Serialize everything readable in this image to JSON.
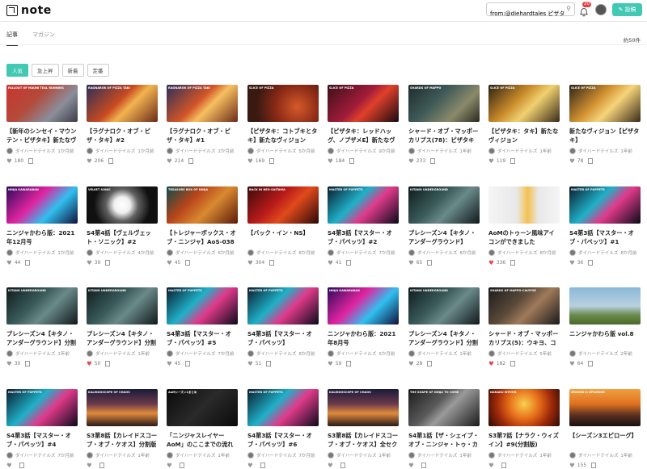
{
  "header": {
    "logo_text": "note",
    "search_value": "from:@diehardtales ピザタキ",
    "notification_count": "20",
    "post_label": "投稿"
  },
  "tabs": [
    {
      "label": "記事"
    },
    {
      "label": "マガジン"
    }
  ],
  "count": "約50件",
  "filters": [
    {
      "label": "人気"
    },
    {
      "label": "急上昇"
    },
    {
      "label": "新着"
    },
    {
      "label": "定番"
    }
  ],
  "colors": {
    "accent": "#41c9b4",
    "like_on": "#e34a4a"
  },
  "cards": [
    {
      "title": "【新年のシンセイ・マウンテン・ピザタキ】新たなヴィジョン",
      "author": "ダイハードテイルズ",
      "time": "1か月前",
      "likes": "180",
      "liked": false,
      "thumb_caption": "FALLOUT OF MAUNI\nTEAL RUNNING",
      "thumb": "linear-gradient(135deg,#c9352f,#b44a3a 40%,#8a8e9a 70%,#3a3d48)"
    },
    {
      "title": "【ラグナロク・オブ・ピザ・タキ】#2",
      "author": "ダイハードテイルズ",
      "time": "1か月前",
      "likes": "206",
      "liked": false,
      "thumb_caption": "RAGNAROK OF PIZZA TAKI",
      "thumb": "linear-gradient(135deg,#2a2f5a,#c84a20 45%,#f2b450 60%,#6a2a18)"
    },
    {
      "title": "【ラグナロク・オブ・ピザ・タキ】#1",
      "author": "ダイハードテイルズ",
      "time": "2か月前",
      "likes": "214",
      "liked": false,
      "thumb_caption": "RAGNAROK OF PIZZA TAKI",
      "thumb": "linear-gradient(135deg,#2a2f5a,#d25528 45%,#f7c060 60%,#6a2a18)"
    },
    {
      "title": "【ピザタキ：コトブキとタキ】新たなヴィジョン",
      "author": "ダイハードテイルズ",
      "time": "5か月前",
      "likes": "169",
      "liked": false,
      "thumb_caption": "SLICE OF PIZZA",
      "thumb": "radial-gradient(circle at 70% 60%,#d65a2a,#8a2a16 40%,#3a1a10 75%)"
    },
    {
      "title": "【ピザタキ：レッドハッグ、ノプザメE】新たなヴィジョン",
      "author": "ダイハードテイルズ",
      "time": "9か月前",
      "likes": "184",
      "liked": false,
      "thumb_caption": "SLICE OF PIZZA",
      "thumb": "linear-gradient(135deg,#3a0f18,#a01c3a 45%,#e0402a 60%,#1a0a10)"
    },
    {
      "title": "シャード・オブ・マッポーカリプス(78)：ピザタキ",
      "author": "ダイハードテイルズ",
      "time": "1年前",
      "likes": "233",
      "liked": false,
      "thumb_caption": "SHARDS OF MAPPO",
      "thumb": "linear-gradient(135deg,#1e2a2c,#3f5a58 40%,#8a8a6a 70%,#2a2a20)"
    },
    {
      "title": "【ピザタキ：タキ】新たなヴィジョン",
      "author": "ダイハードテイルズ",
      "time": "1年前",
      "likes": "119",
      "liked": false,
      "thumb_caption": "SLICE OF PIZZA",
      "thumb": "linear-gradient(135deg,#2a2012,#c88a2a 40%,#f0d070 60%,#3a2a18)"
    },
    {
      "title": "新たなヴィジョン【ピザタキ】",
      "author": "ダイハードテイルズ",
      "time": "1年前",
      "likes": "78",
      "liked": false,
      "thumb_caption": "SLICE OF PIZZA",
      "thumb": "linear-gradient(135deg,#2a2218,#d09030 40%,#f6d47a 60%,#3a2a18)"
    },
    {
      "title": "ニンジャかわら版：2021年12月号",
      "author": "ダイハードテイルズ",
      "time": "1か月前",
      "likes": "44",
      "liked": false,
      "thumb_caption": "NINJA KAWARABAN",
      "thumb": "linear-gradient(135deg,#2a0a5a,#e024a0 40%,#30c0f0 65%,#10103a)"
    },
    {
      "title": "S4第4話【ヴェルヴェット・ソニック】#2",
      "author": "ダイハードテイルズ",
      "time": "4か月前",
      "likes": "39",
      "liked": false,
      "thumb_caption": "VELVET SONIC",
      "thumb": "radial-gradient(circle at 50% 50%,#ffffff,#f0f0f0 20%,#606060 40%,#101010 70%)"
    },
    {
      "title": "【トレジャーボックス・オブ・ニンジャ】AoS-038「タキ」",
      "author": "ダイハードテイルズ",
      "time": "6か月前",
      "likes": "45",
      "liked": false,
      "thumb_caption": "TREASURE BOX OF NINJA",
      "thumb": "linear-gradient(135deg,#0c4a4a,#b8451a 35%,#d88a30 60%,#5a1a0a)"
    },
    {
      "title": "【バック・イン・NS】",
      "author": "ダイハードテイルズ",
      "time": "8か月前",
      "likes": "304",
      "liked": false,
      "thumb_caption": "BACK IN NEO-SAITAMA",
      "thumb": "linear-gradient(135deg,#3a0a0a,#b81a1a 40%,#e04a1a 60%,#2a0808)"
    },
    {
      "title": "S4第3話【マスター・オブ・パペッツ】#2",
      "author": "ダイハードテイルズ",
      "time": "7か月前",
      "likes": "41",
      "liked": false,
      "thumb_caption": "MASTER OF PUPPETS",
      "thumb": "linear-gradient(135deg,#0a1a2a,#20b0c8 40%,#e03a8a 60%,#0a0a1a)"
    },
    {
      "title": "プレシーズン4【キタノ・アンダーグラウンド】",
      "author": "ダイハードテイルズ",
      "time": "8か月前",
      "likes": "65",
      "liked": false,
      "thumb_caption": "KITANO UNDERGROUND",
      "thumb": "linear-gradient(135deg,#0e1a1c,#3a5a5a 40%,#6a8a8a 60%,#10181a)"
    },
    {
      "title": "AoMのトゥーン風味アイコンができました",
      "author": "ダイハードテイルズ",
      "time": "8か月前",
      "likes": "336",
      "liked": true,
      "thumb_caption": "",
      "thumb": "linear-gradient(90deg,#f5f5f5,#e8e8e8 40%,#f4c050 55%,#e8e8e8 70%,#f5f5f5)"
    },
    {
      "title": "S4第3話【マスター・オブ・パペッツ】#1",
      "author": "ダイハードテイルズ",
      "time": "8か月前",
      "likes": "36",
      "liked": false,
      "thumb_caption": "MASTER OF PUPPETS",
      "thumb": "linear-gradient(135deg,#0a1a2a,#20b0c8 40%,#e03a8a 60%,#0a0a1a)"
    },
    {
      "title": "プレシーズン4【キタノ・アンダーグラウンド】分割版#2",
      "author": "ダイハードテイルズ",
      "time": "1年前",
      "likes": "30",
      "liked": false,
      "thumb_caption": "KITANO UNDERGROUND",
      "thumb": "linear-gradient(135deg,#0e1a1c,#3a5a5a 40%,#6a8a8a 60%,#10181a)"
    },
    {
      "title": "プレシーズン4【キタノ・アンダーグラウンド】分割版#5",
      "author": "ダイハードテイルズ",
      "time": "1年前",
      "likes": "50",
      "liked": true,
      "thumb_caption": "KITANO UNDERGROUND",
      "thumb": "linear-gradient(135deg,#0e1a1c,#3a5a5a 40%,#6a8a8a 60%,#10181a)"
    },
    {
      "title": "S4第3話【マスター・オブ・パペッツ】#5",
      "author": "ダイハードテイルズ",
      "time": "7か月前",
      "likes": "45",
      "liked": false,
      "thumb_caption": "MASTER OF PUPPETS",
      "thumb": "linear-gradient(135deg,#0a1a2a,#20b0c8 40%,#e03a8a 60%,#0a0a1a)"
    },
    {
      "title": "S4第3話【マスター・オブ・パペッツ】",
      "author": "ダイハードテイルズ",
      "time": "8か月前",
      "likes": "51",
      "liked": false,
      "thumb_caption": "MASTER OF PUPPETS",
      "thumb": "linear-gradient(135deg,#0a1a2a,#20b0c8 40%,#e03a8a 60%,#0a0a1a)"
    },
    {
      "title": "ニンジャかわら版：2021年8月号",
      "author": "ダイハードテイルズ",
      "time": "5か月前",
      "likes": "59",
      "liked": false,
      "thumb_caption": "NINJA KAWARABAN",
      "thumb": "linear-gradient(135deg,#2a0a5a,#e024a0 40%,#30c0f0 65%,#10103a)"
    },
    {
      "title": "プレシーズン4【キタノ・アンダーグラウンド】分割版#1",
      "author": "ダイハードテイルズ",
      "time": "1年前",
      "likes": "28",
      "liked": false,
      "thumb_caption": "KITANO UNDERGROUND",
      "thumb": "linear-gradient(135deg,#0e1a1c,#3a5a5a 40%,#6a8a8a 60%,#10181a)"
    },
    {
      "title": "シャード・オブ・マッポーカリプス(5)：ウキヨ、コトブキ",
      "author": "ダイハードテイルズ",
      "time": "5年前",
      "likes": "182",
      "liked": true,
      "thumb_caption": "SHARDS OF MAPPO-CALYPSE",
      "thumb": "linear-gradient(135deg,#1a1a1a,#5a4a3a 40%,#a07a5a 60%,#1a1a1a)"
    },
    {
      "title": "ニンジャかわら版 vol.8",
      "author": "ダイハードテイルズ",
      "time": "2年前",
      "likes": "64",
      "liked": false,
      "thumb_caption": "",
      "thumb": "linear-gradient(180deg,#8ab8d8,#b8d0e0 50%,#6a8a4a 75%,#4a6a2a)"
    },
    {
      "title": "S4第3話【マスター・オブ・パペッツ】#4",
      "author": "ダイハードテイルズ",
      "time": "7か月前",
      "likes": "",
      "liked": false,
      "thumb_caption": "MASTER OF PUPPETS",
      "thumb": "linear-gradient(135deg,#0a1a2a,#20b0c8 40%,#e03a8a 60%,#0a0a1a)"
    },
    {
      "title": "S3第8話【カレイドスコープ・オブ・ケオス】分割版#2",
      "author": "ダイハードテイルズ",
      "time": "1年前",
      "likes": "",
      "liked": false,
      "thumb_caption": "KALEIDOSCOPE OF CHAOS",
      "thumb": "linear-gradient(180deg,#1a1a3a,#6a3a4a 40%,#e08a3a 65%,#2a1a1a)"
    },
    {
      "title": "「ニンジャスレイヤーAoM」のここまでの流れが3分でわかるまとめ",
      "author": "ダイハードテイルズ",
      "time": "1年前",
      "likes": "",
      "liked": false,
      "thumb_caption": "AoMシーズン1まとめ",
      "thumb": "linear-gradient(135deg,#0a0a0a,#2a2a2a 50%,#0a0a0a)"
    },
    {
      "title": "S4第3話【マスター・オブ・パペッツ】#6",
      "author": "ダイハードテイルズ",
      "time": "7か月前",
      "likes": "",
      "liked": false,
      "thumb_caption": "MASTER OF PUPPETS",
      "thumb": "linear-gradient(135deg,#0a1a2a,#20b0c8 40%,#e03a8a 60%,#0a0a1a)"
    },
    {
      "title": "S3第8話【カレイドスコープ・オブ・ケオス】全セクション版",
      "author": "ダイハードテイルズ",
      "time": "1年前",
      "likes": "",
      "liked": false,
      "thumb_caption": "KALEIDOSCOPE OF CHAOS",
      "thumb": "linear-gradient(180deg,#1a1a3a,#6a3a4a 40%,#e08a3a 65%,#2a1a1a)"
    },
    {
      "title": "S4第1話【ザ・シェイプ・オブ・ニンジャ・トゥ・カム】分割版#1",
      "author": "ダイハードテイルズ",
      "time": "1年前",
      "likes": "",
      "liked": false,
      "thumb_caption": "THE SHAPE OF NINJA TO COME",
      "thumb": "linear-gradient(135deg,#1a1a1a,#5a5a5a 40%,#9a9a9a 55%,#1a1a1a)"
    },
    {
      "title": "S3第7話【ナラク・ウィズイン】#9(分割版)",
      "author": "ダイハードテイルズ",
      "time": "1年前",
      "likes": "",
      "liked": false,
      "thumb_caption": "NARAKU WITHIN",
      "thumb": "radial-gradient(circle at 50% 40%,#f8d050,#e8701a 35%,#a02a0a 65%,#2a0a05)"
    },
    {
      "title": "【シーズン3エピローグ】",
      "author": "ダイハードテイルズ",
      "time": "1年前",
      "likes": "155",
      "liked": false,
      "thumb_caption": "SEASON 3: EPILOGUE",
      "thumb": "linear-gradient(180deg,#f0a040,#e07020 40%,#5a3020 70%,#1a1010)"
    }
  ]
}
